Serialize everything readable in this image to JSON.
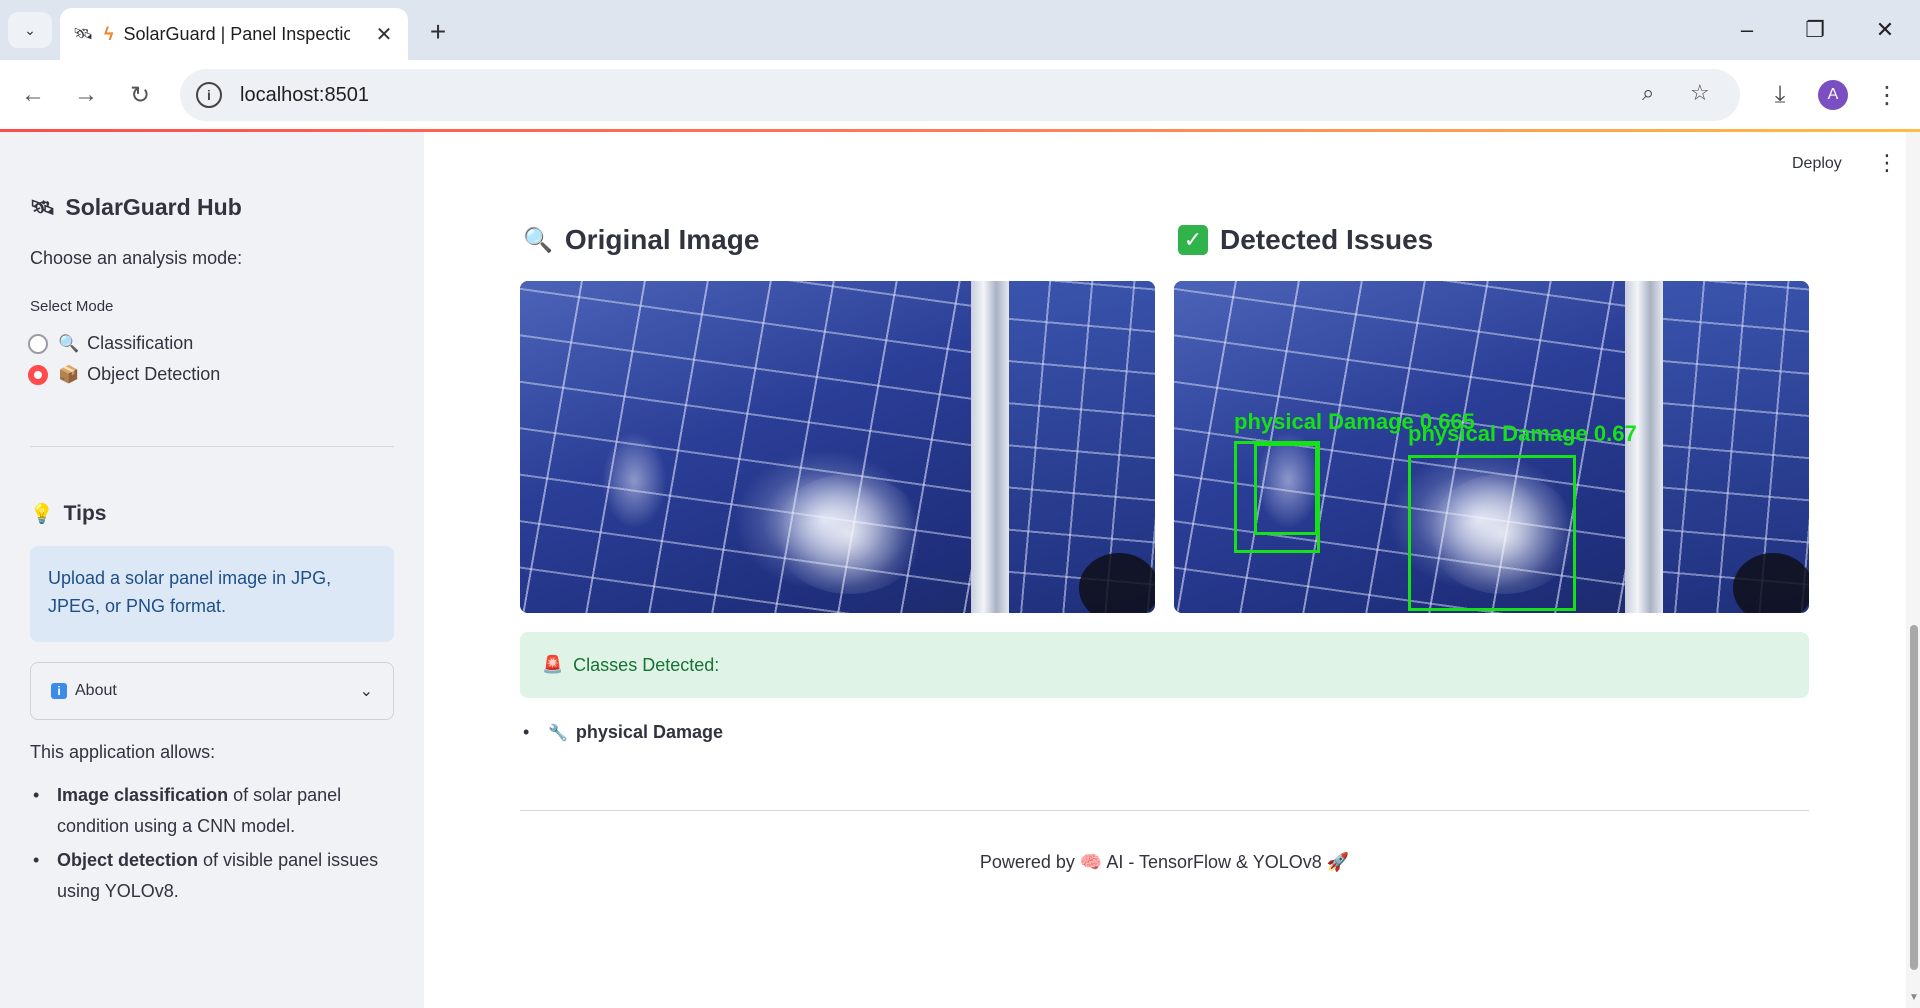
{
  "browser": {
    "tab_title": "SolarGuard | Panel Inspection",
    "url": "localhost:8501",
    "profile_initial": "A",
    "icons": [
      "chevron-down-icon",
      "satellite-icon",
      "bolt-icon",
      "close-icon",
      "plus-icon",
      "minimize-icon",
      "restore-icon",
      "close-window-icon",
      "back-icon",
      "forward-icon",
      "reload-icon",
      "info-icon",
      "zoom-icon",
      "star-icon",
      "download-icon",
      "more-icon"
    ]
  },
  "app": {
    "deploy_label": "Deploy"
  },
  "sidebar": {
    "title": "SolarGuard Hub",
    "prompt": "Choose an analysis mode:",
    "select_label": "Select Mode",
    "options": [
      {
        "label": "Classification",
        "selected": false
      },
      {
        "label": "Object Detection",
        "selected": true
      }
    ],
    "tips_title": "Tips",
    "tips_text": "Upload a solar panel image in JPG, JPEG, or PNG format.",
    "about_label": "About",
    "app_allows": "This application allows:",
    "features": [
      {
        "bold": "Image classification",
        "rest": " of solar panel condition using a CNN model."
      },
      {
        "bold": "Object detection",
        "rest": " of visible panel issues using YOLOv8."
      }
    ]
  },
  "main": {
    "original_title": "Original Image",
    "detected_title": "Detected Issues",
    "detections": [
      {
        "label": "physical Damage 0.665"
      },
      {
        "label": "physical Damage 0.67"
      }
    ],
    "classes_detected": "Classes Detected:",
    "classes": [
      "physical Damage"
    ],
    "footer": "Powered by 🧠 AI - TensorFlow & YOLOv8 🚀"
  },
  "colors": {
    "accent": "#ff4b4b",
    "sidebar_bg": "#f0f2f6",
    "info_bg": "#dde8f6",
    "success_bg": "#dff4e6",
    "bbox": "#16e016"
  }
}
